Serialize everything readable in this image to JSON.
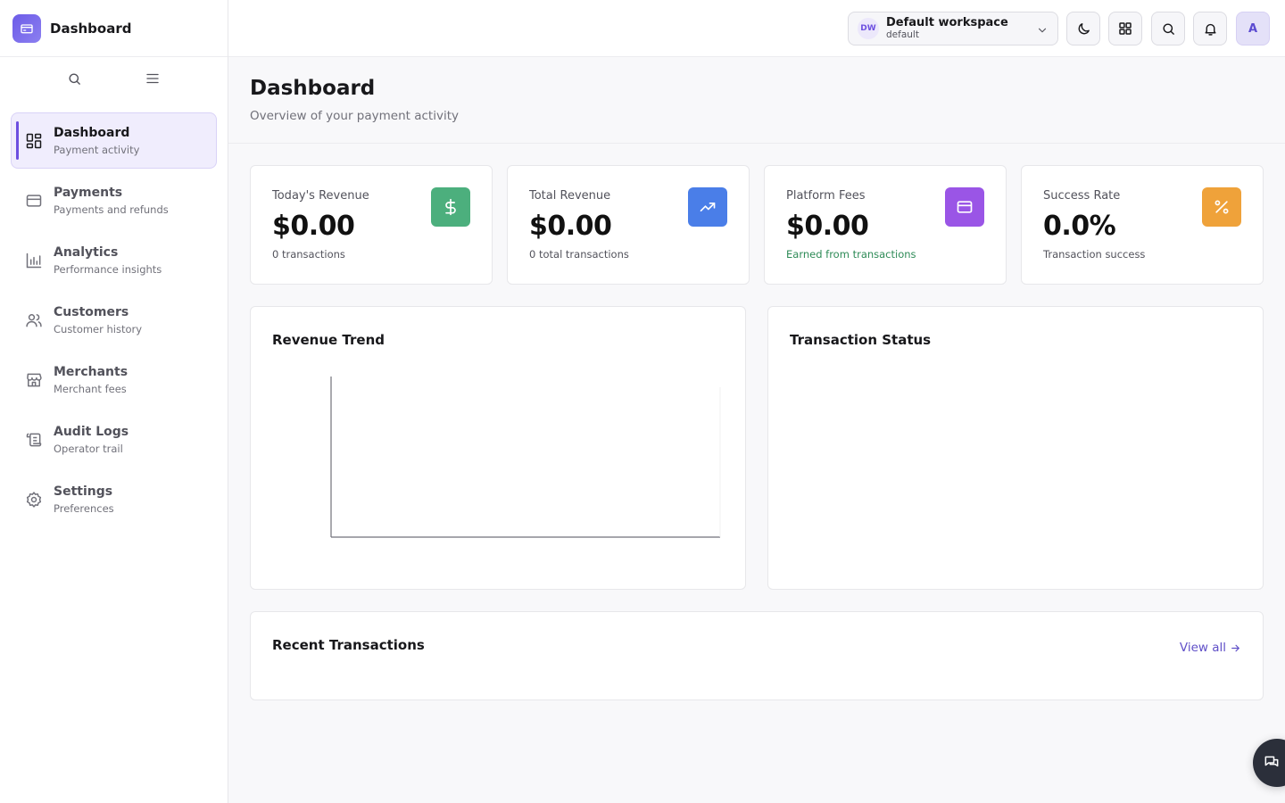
{
  "brand": {
    "title": "Dashboard"
  },
  "sidebar": {
    "items": [
      {
        "label": "Dashboard",
        "sub": "Payment activity",
        "icon": "dashboard-grid-icon"
      },
      {
        "label": "Payments",
        "sub": "Payments and refunds",
        "icon": "credit-card-icon"
      },
      {
        "label": "Analytics",
        "sub": "Performance insights",
        "icon": "bar-chart-icon"
      },
      {
        "label": "Customers",
        "sub": "Customer history",
        "icon": "users-icon"
      },
      {
        "label": "Merchants",
        "sub": "Merchant fees",
        "icon": "store-icon"
      },
      {
        "label": "Audit Logs",
        "sub": "Operator trail",
        "icon": "scroll-icon"
      },
      {
        "label": "Settings",
        "sub": "Preferences",
        "icon": "gear-icon"
      }
    ]
  },
  "header": {
    "workspace": {
      "badge": "DW",
      "name": "Default workspace",
      "sub": "default"
    },
    "avatar": "A"
  },
  "page": {
    "title": "Dashboard",
    "subtitle": "Overview of your payment activity"
  },
  "stats": [
    {
      "label": "Today's Revenue",
      "value": "$0.00",
      "note": "0 transactions",
      "icon": "dollar-icon",
      "color": "#4caf7d"
    },
    {
      "label": "Total Revenue",
      "value": "$0.00",
      "note": "0 total transactions",
      "icon": "trending-up-icon",
      "color": "#4a7ee8"
    },
    {
      "label": "Platform Fees",
      "value": "$0.00",
      "note": "Earned from transactions",
      "icon": "credit-card-icon",
      "color": "#9a55e6"
    },
    {
      "label": "Success Rate",
      "value": "0.0%",
      "note": "Transaction success",
      "icon": "percent-icon",
      "color": "#efa23a"
    }
  ],
  "revenue_trend": {
    "title": "Revenue Trend"
  },
  "transaction_status": {
    "title": "Transaction Status"
  },
  "recent": {
    "title": "Recent Transactions",
    "view_all": "View all"
  },
  "colors": {
    "accent": "#6d4fe0",
    "link": "#6050c8"
  }
}
